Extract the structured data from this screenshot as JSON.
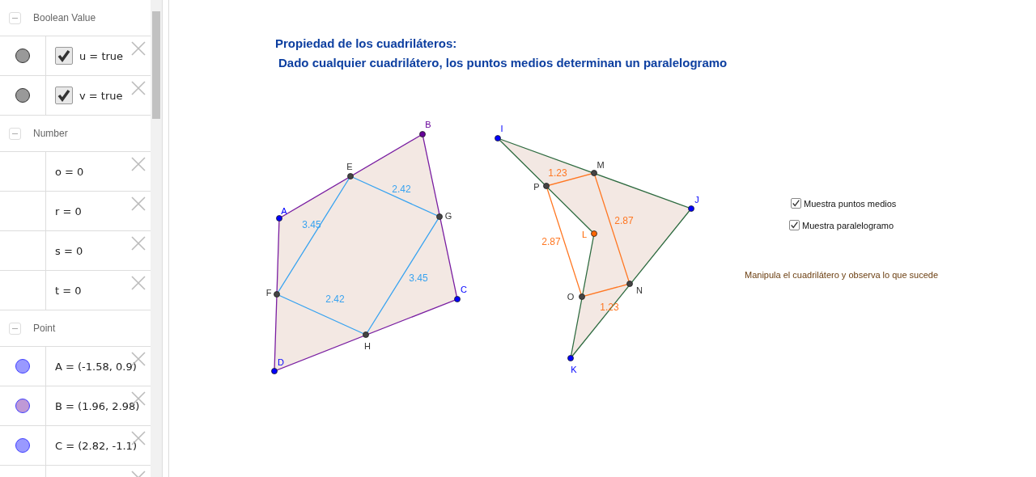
{
  "algebra_view": {
    "groups": [
      {
        "title": "Boolean Value",
        "expanded": true,
        "items": [
          {
            "kind": "boolean",
            "text": "u = true",
            "checked": true,
            "color": "#999999"
          },
          {
            "kind": "boolean",
            "text": "v = true",
            "checked": true,
            "color": "#999999"
          }
        ]
      },
      {
        "title": "Number",
        "expanded": true,
        "items": [
          {
            "kind": "number",
            "text": "o = 0"
          },
          {
            "kind": "number",
            "text": "r = 0"
          },
          {
            "kind": "number",
            "text": "s = 0"
          },
          {
            "kind": "number",
            "text": "t = 0"
          }
        ]
      },
      {
        "title": "Point",
        "expanded": true,
        "items": [
          {
            "kind": "point",
            "text": "A = (-1.58, 0.9)",
            "color": "#9999ff"
          },
          {
            "kind": "point",
            "text": "B = (1.96, 2.98)",
            "color": "#bf99d6"
          },
          {
            "kind": "point",
            "text": "C = (2.82, -1.1)",
            "color": "#9999ff"
          },
          {
            "kind": "empty"
          }
        ]
      }
    ]
  },
  "graphics": {
    "title_lines": [
      "Propiedad de los cuadriláteros:",
      "Dado cualquier cuadrilátero, los puntos medios determinan un paralelogramo"
    ],
    "figures": [
      {
        "points": [
          {
            "label": "A",
            "color": "#0000ff"
          },
          {
            "label": "B",
            "color": "#660099"
          },
          {
            "label": "C",
            "color": "#0000ff"
          },
          {
            "label": "D",
            "color": "#0000ff"
          },
          {
            "label": "E",
            "color": "#444444"
          },
          {
            "label": "F",
            "color": "#444444"
          },
          {
            "label": "G",
            "color": "#444444"
          },
          {
            "label": "H",
            "color": "#444444"
          }
        ],
        "segment_labels": [
          "2.42",
          "3.45",
          "3.45",
          "2.42"
        ]
      },
      {
        "points": [
          {
            "label": "I",
            "color": "#0000ff"
          },
          {
            "label": "J",
            "color": "#0000ff"
          },
          {
            "label": "K",
            "color": "#0000ff"
          },
          {
            "label": "L",
            "color": "#ff6600"
          },
          {
            "label": "M",
            "color": "#444444"
          },
          {
            "label": "N",
            "color": "#444444"
          },
          {
            "label": "O",
            "color": "#444444"
          },
          {
            "label": "P",
            "color": "#444444"
          }
        ],
        "segment_labels": [
          "1.23",
          "2.87",
          "2.87",
          "1.23"
        ]
      }
    ],
    "checkboxes": [
      {
        "label": "Muestra puntos medios",
        "checked": true
      },
      {
        "label": "Muestra paralelogramo",
        "checked": true
      }
    ],
    "note": "Manipula el cuadrilátero y observa lo que sucede"
  }
}
